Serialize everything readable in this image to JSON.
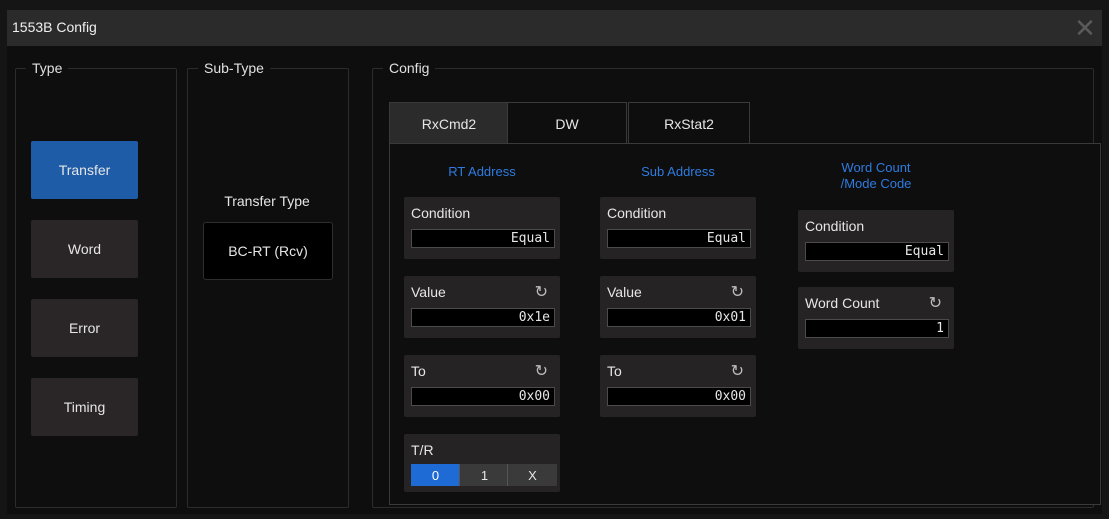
{
  "window": {
    "title": "1553B Config",
    "close_icon": "close-icon"
  },
  "type_group": {
    "label": "Type",
    "items": [
      "Transfer",
      "Word",
      "Error",
      "Timing"
    ],
    "selected": "Transfer"
  },
  "subtype_group": {
    "label": "Sub-Type",
    "transfer_type_label": "Transfer Type",
    "transfer_type_value": "BC-RT (Rcv)"
  },
  "config_group": {
    "label": "Config",
    "tabs": [
      "RxCmd2",
      "DW",
      "RxStat2"
    ],
    "selected_tab": "RxCmd2",
    "rt_address": {
      "header": "RT Address",
      "condition_label": "Condition",
      "condition_value": "Equal",
      "value_label": "Value",
      "value": "0x1e",
      "to_label": "To",
      "to_value": "0x00"
    },
    "sub_address": {
      "header": "Sub Address",
      "condition_label": "Condition",
      "condition_value": "Equal",
      "value_label": "Value",
      "value": "0x01",
      "to_label": "To",
      "to_value": "0x00"
    },
    "word_count": {
      "header_line1": "Word Count",
      "header_line2": "/Mode Code",
      "condition_label": "Condition",
      "condition_value": "Equal",
      "count_label": "Word Count",
      "count_value": "1"
    },
    "tr": {
      "label": "T/R",
      "options": [
        "0",
        "1",
        "X"
      ],
      "selected": "0"
    }
  },
  "colors": {
    "accent": "#1f5ca8",
    "header_blue": "#2f7be0",
    "background": "#0e0e0e"
  }
}
